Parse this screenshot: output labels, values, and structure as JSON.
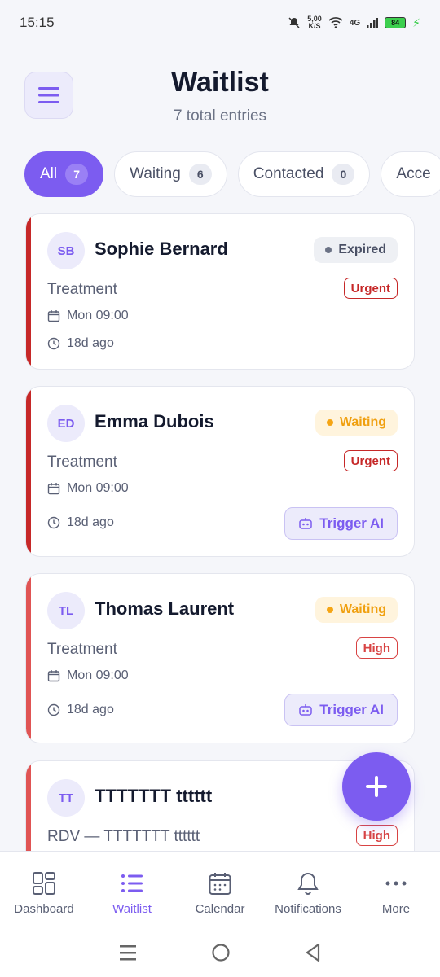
{
  "status_bar": {
    "time": "15:15",
    "speed": "5,00",
    "speed_unit": "K/S",
    "network": "4G",
    "battery": "84"
  },
  "header": {
    "title": "Waitlist",
    "subtitle": "7 total entries"
  },
  "filters": [
    {
      "label": "All",
      "count": "7",
      "active": true
    },
    {
      "label": "Waiting",
      "count": "6",
      "active": false
    },
    {
      "label": "Contacted",
      "count": "0",
      "active": false
    },
    {
      "label": "Acce",
      "count": "",
      "active": false
    }
  ],
  "entries": [
    {
      "initials": "SB",
      "name": "Sophie Bernard",
      "status": "Expired",
      "service": "Treatment",
      "priority": "Urgent",
      "date": "Mon 09:00",
      "ago": "18d ago",
      "action": ""
    },
    {
      "initials": "ED",
      "name": "Emma Dubois",
      "status": "Waiting",
      "service": "Treatment",
      "priority": "Urgent",
      "date": "Mon 09:00",
      "ago": "18d ago",
      "action": "Trigger AI"
    },
    {
      "initials": "TL",
      "name": "Thomas Laurent",
      "status": "Waiting",
      "service": "Treatment",
      "priority": "High",
      "date": "Mon 09:00",
      "ago": "18d ago",
      "action": "Trigger AI"
    },
    {
      "initials": "TT",
      "name": "TTTTTTT tttttt",
      "status": "",
      "service": "RDV — TTTTTTT tttttt",
      "priority": "High",
      "date": "",
      "ago": "",
      "action": ""
    }
  ],
  "nav": [
    {
      "label": "Dashboard",
      "icon": "grid-icon"
    },
    {
      "label": "Waitlist",
      "icon": "list-icon",
      "active": true
    },
    {
      "label": "Calendar",
      "icon": "calendar-icon"
    },
    {
      "label": "Notifications",
      "icon": "bell-icon"
    },
    {
      "label": "More",
      "icon": "more-icon"
    }
  ],
  "colors": {
    "accent": "#7c5cf0",
    "urgent": "#c62828",
    "high": "#e05454",
    "waiting": "#f5a515"
  }
}
